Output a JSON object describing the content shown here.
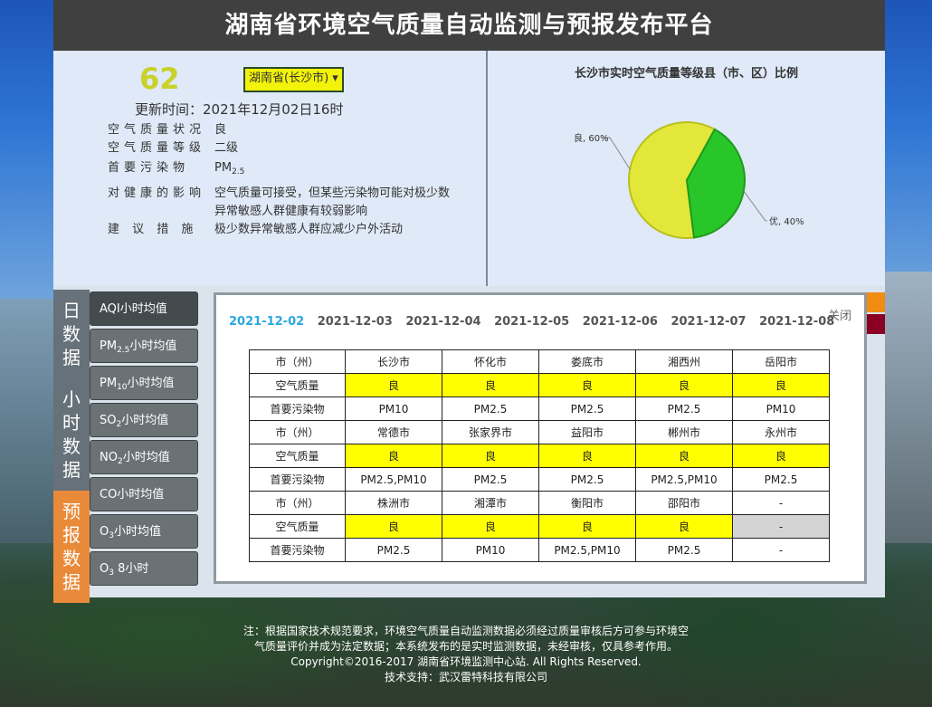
{
  "header": {
    "title": "湖南省环境空气质量自动监测与预报发布平台"
  },
  "summary": {
    "aqi": "62",
    "city_select": "湖南省(长沙市)",
    "update_label": "更新时间：",
    "update_time": "2021年12月02日16时",
    "rows": [
      {
        "key": "空气质量状况",
        "value": "良"
      },
      {
        "key": "空气质量等级",
        "value": "二级"
      },
      {
        "key": "首要污染物",
        "value": "PM",
        "value_sub": "2.5"
      },
      {
        "key": "对健康的影响",
        "value": "空气质量可接受，但某些污染物可能对极少数异常敏感人群健康有较弱影响"
      },
      {
        "key": "建 议 措 施",
        "value": "极少数异常敏感人群应减少户外活动"
      }
    ]
  },
  "chart_data": {
    "type": "pie",
    "title": "长沙市实时空气质量等级县（市、区）比例",
    "categories": [
      "良",
      "优"
    ],
    "values": [
      60,
      40
    ],
    "labels": [
      "良, 60%",
      "优, 40%"
    ],
    "colors": [
      "#e3e73a",
      "#29c629"
    ]
  },
  "side_tabs": [
    {
      "label": "日数据",
      "color": "#667179"
    },
    {
      "label": "小时数据",
      "color": "#667179"
    },
    {
      "label": "预报数据",
      "color": "#e98a3a"
    }
  ],
  "menu": [
    {
      "label": "AQI小时均值",
      "active": true
    },
    {
      "label": "PM",
      "sub": "2.5",
      "suffix": "小时均值"
    },
    {
      "label": "PM",
      "sub": "10",
      "suffix": "小时均值"
    },
    {
      "label": "SO",
      "sub": "2",
      "suffix": "小时均值"
    },
    {
      "label": "NO",
      "sub": "2",
      "suffix": "小时均值"
    },
    {
      "label": "CO小时均值"
    },
    {
      "label": "O",
      "sub": "3",
      "suffix": "小时均值"
    },
    {
      "label": "O",
      "sub": "3",
      "suffix": " 8小时"
    }
  ],
  "forecast": {
    "close_label": "关闭",
    "dates": [
      "2021-12-02",
      "2021-12-03",
      "2021-12-04",
      "2021-12-05",
      "2021-12-06",
      "2021-12-07",
      "2021-12-08"
    ],
    "active_date": "2021-12-02",
    "row_labels": {
      "city": "市（州）",
      "quality": "空气质量",
      "pollutant": "首要污染物"
    },
    "groups": [
      {
        "cities": [
          "长沙市",
          "怀化市",
          "娄底市",
          "湘西州",
          "岳阳市"
        ],
        "quality": [
          "良",
          "良",
          "良",
          "良",
          "良"
        ],
        "pollutant": [
          "PM10",
          "PM2.5",
          "PM2.5",
          "PM2.5",
          "PM10"
        ]
      },
      {
        "cities": [
          "常德市",
          "张家界市",
          "益阳市",
          "郴州市",
          "永州市"
        ],
        "quality": [
          "良",
          "良",
          "良",
          "良",
          "良"
        ],
        "pollutant": [
          "PM2.5,PM10",
          "PM2.5",
          "PM2.5",
          "PM2.5,PM10",
          "PM2.5"
        ]
      },
      {
        "cities": [
          "株洲市",
          "湘潭市",
          "衡阳市",
          "邵阳市",
          "-"
        ],
        "quality": [
          "良",
          "良",
          "良",
          "良",
          "-"
        ],
        "pollutant": [
          "PM2.5",
          "PM10",
          "PM2.5,PM10",
          "PM2.5",
          "-"
        ]
      }
    ]
  },
  "footer": {
    "lines": [
      "注：根据国家技术规范要求，环境空气质量自动监测数据必须经过质量审核后方可参与环境空",
      "气质量评价并成为法定数据；本系统发布的是实时监测数据，未经审核，仅具参考作用。",
      "Copyright©2016-2017 湖南省环境监测中心站. All Rights Reserved.",
      "技术支持：武汉雷特科技有限公司"
    ]
  }
}
